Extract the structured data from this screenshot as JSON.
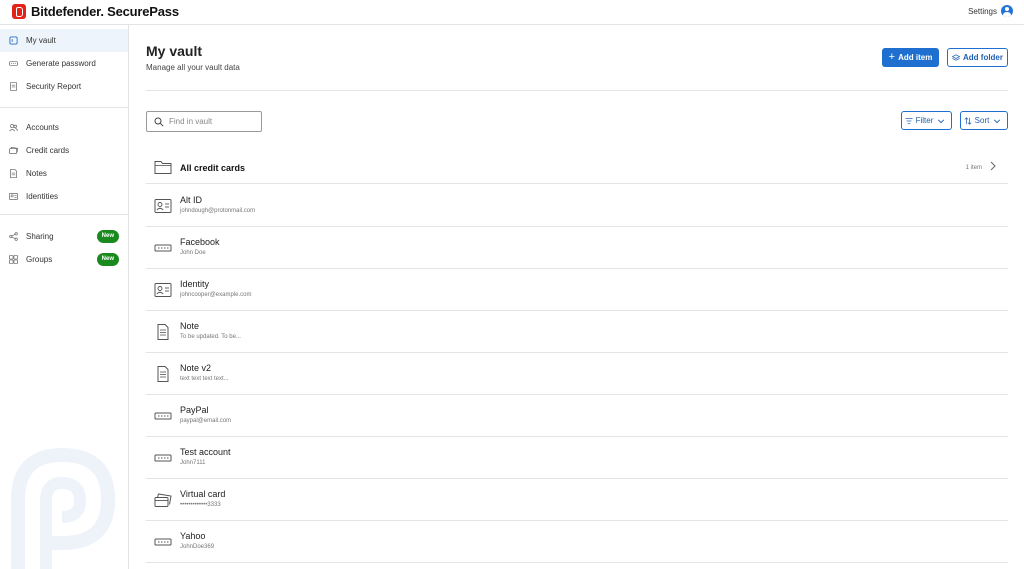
{
  "brand": {
    "name": "Bitdefender. SecurePass"
  },
  "topbar": {
    "settings_label": "Settings"
  },
  "sidebar": {
    "items": [
      {
        "label": "My vault",
        "icon": "vault-icon",
        "active": true
      },
      {
        "label": "Generate password",
        "icon": "password-generator-icon"
      },
      {
        "label": "Security Report",
        "icon": "report-icon"
      },
      {
        "label": "Accounts",
        "icon": "accounts-icon"
      },
      {
        "label": "Credit cards",
        "icon": "credit-card-icon"
      },
      {
        "label": "Notes",
        "icon": "note-icon"
      },
      {
        "label": "Identities",
        "icon": "identity-icon"
      },
      {
        "label": "Sharing",
        "icon": "share-icon",
        "badge": "New"
      },
      {
        "label": "Groups",
        "icon": "groups-icon",
        "badge": "New"
      }
    ]
  },
  "header": {
    "title": "My vault",
    "subtitle": "Manage all your vault data",
    "add_item_label": "Add item",
    "add_folder_label": "Add folder"
  },
  "toolbar": {
    "search_placeholder": "Find in vault",
    "filter_label": "Filter",
    "sort_label": "Sort"
  },
  "folder": {
    "title": "All credit cards",
    "count": "1 item"
  },
  "items": [
    {
      "title": "Alt ID",
      "subtitle": "johndough@protonmail.com",
      "icon": "identity-card-icon"
    },
    {
      "title": "Facebook",
      "subtitle": "John Doe",
      "icon": "password-field-icon"
    },
    {
      "title": "Identity",
      "subtitle": "johncooper@example.com",
      "icon": "identity-card-icon"
    },
    {
      "title": "Note",
      "subtitle": "To be updated. To be...",
      "icon": "note-document-icon"
    },
    {
      "title": "Note v2",
      "subtitle": "text text text text...",
      "icon": "note-document-icon"
    },
    {
      "title": "PayPal",
      "subtitle": "paypal@email.com",
      "icon": "password-field-icon"
    },
    {
      "title": "Test account",
      "subtitle": "John7111",
      "icon": "password-field-icon"
    },
    {
      "title": "Virtual card",
      "subtitle": "•••••••••••••3333",
      "icon": "credit-card-stack-icon"
    },
    {
      "title": "Yahoo",
      "subtitle": "JohnDoe369",
      "icon": "password-field-icon"
    }
  ],
  "colors": {
    "accent": "#1f6fd0",
    "brand_red": "#e2231a",
    "badge_green": "#1a8a1f",
    "active_nav_bg": "#eef4fb"
  }
}
